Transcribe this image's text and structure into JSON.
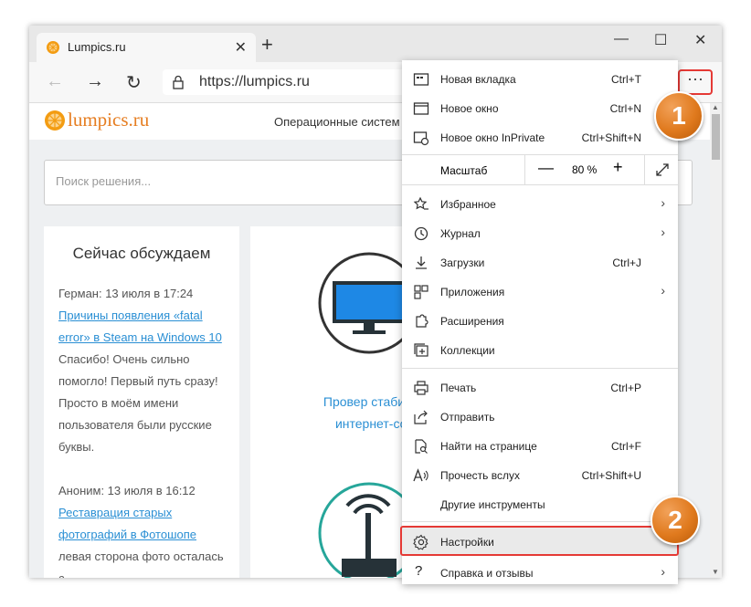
{
  "tab": {
    "title": "Lumpics.ru",
    "favicon": "orange-icon"
  },
  "window_controls": {
    "minimize": "—",
    "maximize": "☐",
    "close": "✕"
  },
  "address": {
    "url": "https://lumpics.ru"
  },
  "site": {
    "logo_text": "lumpics.ru",
    "nav_text": "Операционные систем",
    "search_placeholder": "Поиск решения...",
    "discuss_title": "Сейчас обсуждаем",
    "comments": [
      {
        "author": "Герман: 13 июля в 17:24",
        "link": "Причины появления «fatal error» в Steam на Windows 10",
        "text": "Спасибо! Очень сильно помогло! Первый путь сразу! Просто в моём имени пользователя были русские буквы."
      },
      {
        "author": "Аноним: 13 июля в 16:12",
        "link": "Реставрация старых фотографий в Фотошопе",
        "text": "левая сторона фото осталась с"
      }
    ],
    "card2_link": "Провер стабильно интернет-соед"
  },
  "menu": {
    "items_top": [
      {
        "icon": "new-tab-icon",
        "label": "Новая вкладка",
        "shortcut": "Ctrl+T"
      },
      {
        "icon": "new-window-icon",
        "label": "Новое окно",
        "shortcut": "Ctrl+N"
      },
      {
        "icon": "inprivate-icon",
        "label": "Новое окно InPrivate",
        "shortcut": "Ctrl+Shift+N"
      }
    ],
    "zoom": {
      "label": "Масштаб",
      "minus": "—",
      "value": "80 %",
      "plus": "+"
    },
    "items_mid": [
      {
        "icon": "favorites-icon",
        "label": "Избранное",
        "chevron": true
      },
      {
        "icon": "history-icon",
        "label": "Журнал",
        "chevron": true
      },
      {
        "icon": "downloads-icon",
        "label": "Загрузки",
        "shortcut": "Ctrl+J"
      },
      {
        "icon": "apps-icon",
        "label": "Приложения",
        "chevron": true
      },
      {
        "icon": "extensions-icon",
        "label": "Расширения"
      },
      {
        "icon": "collections-icon",
        "label": "Коллекции"
      }
    ],
    "items_bot": [
      {
        "icon": "print-icon",
        "label": "Печать",
        "shortcut": "Ctrl+P"
      },
      {
        "icon": "share-icon",
        "label": "Отправить"
      },
      {
        "icon": "find-icon",
        "label": "Найти на странице",
        "shortcut": "Ctrl+F"
      },
      {
        "icon": "read-aloud-icon",
        "label": "Прочесть вслух",
        "shortcut": "Ctrl+Shift+U"
      },
      {
        "icon": "tools-icon",
        "label": "Другие инструменты"
      }
    ],
    "settings": {
      "icon": "gear-icon",
      "label": "Настройки"
    },
    "help": {
      "icon": "help-icon",
      "label": "Справка и отзывы",
      "chevron": true
    }
  },
  "badges": {
    "one": "1",
    "two": "2"
  },
  "colors": {
    "highlight": "#e53935",
    "badge": "#e07a1e",
    "link": "#2a8fd4"
  }
}
